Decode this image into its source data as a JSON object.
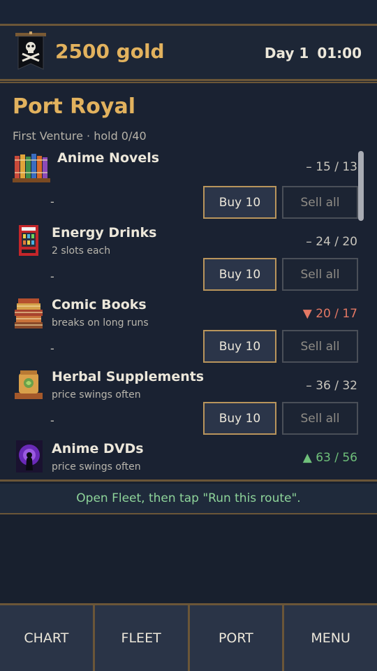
{
  "header": {
    "gold": "2500 gold",
    "day": "Day 1",
    "time": "01:00"
  },
  "port": {
    "name": "Port Royal",
    "subtitle": "First Venture  ·  hold 0/40"
  },
  "items": [
    {
      "name": "Anime Novels",
      "note": "",
      "price": "– 15 / 13",
      "trend": "flat",
      "held": "-",
      "buy_label": "Buy 10",
      "sell_label": "Sell all",
      "icon": "books-icon"
    },
    {
      "name": "Energy Drinks",
      "note": "2 slots each",
      "price": "– 24 / 20",
      "trend": "flat",
      "held": "-",
      "buy_label": "Buy 10",
      "sell_label": "Sell all",
      "icon": "vending-machine-icon"
    },
    {
      "name": "Comic Books",
      "note": "breaks on long runs",
      "price": "▼ 20 / 17",
      "trend": "down",
      "held": "-",
      "buy_label": "Buy 10",
      "sell_label": "Sell all",
      "icon": "comic-stack-icon"
    },
    {
      "name": "Herbal Supplements",
      "note": "price swings often",
      "price": "– 36 / 32",
      "trend": "flat",
      "held": "-",
      "buy_label": "Buy 10",
      "sell_label": "Sell all",
      "icon": "herb-jar-icon"
    },
    {
      "name": "Anime DVDs",
      "note": "price swings often",
      "price": "▲ 63 / 56",
      "trend": "up",
      "icon": "dvd-icon"
    }
  ],
  "hint": "Open Fleet, then tap \"Run this route\".",
  "nav": {
    "chart": "CHART",
    "fleet": "FLEET",
    "port": "PORT",
    "menu": "MENU"
  },
  "colors": {
    "gold": "#e2b25e",
    "frame": "#6b5638",
    "price_down": "#e47864",
    "price_up": "#6fc07a",
    "hint": "#8ed49a"
  }
}
